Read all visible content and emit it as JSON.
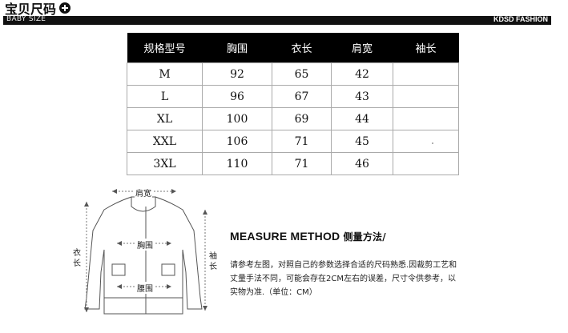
{
  "header": {
    "title": "宝贝尺码",
    "subtitle": "BABY SIZE",
    "brand": "KDSD FASHION"
  },
  "size_table": {
    "columns": [
      "规格型号",
      "胸围",
      "衣长",
      "肩宽",
      "袖长"
    ],
    "rows": [
      [
        "M",
        "92",
        "65",
        "42",
        ""
      ],
      [
        "L",
        "96",
        "67",
        "43",
        ""
      ],
      [
        "XL",
        "100",
        "69",
        "44",
        ""
      ],
      [
        "XXL",
        "106",
        "71",
        "45",
        ""
      ],
      [
        "3XL",
        "110",
        "71",
        "46",
        ""
      ]
    ]
  },
  "diagram": {
    "shoulder": "肩宽",
    "chest": "胸围",
    "waist": "腰围",
    "length": "衣长",
    "sleeve": "袖长"
  },
  "measure": {
    "title_en": "MEASURE METHOD",
    "title_zh": "侧量方法/",
    "line1": "请参考左图，对照自己的参数选择合适的尺码熟悉.因裁剪工艺和",
    "line2": "丈量手法不同，可能会存在2CM左右的误差，尺寸令供参考，以",
    "line3": "实物为准.（单位：CM）"
  }
}
